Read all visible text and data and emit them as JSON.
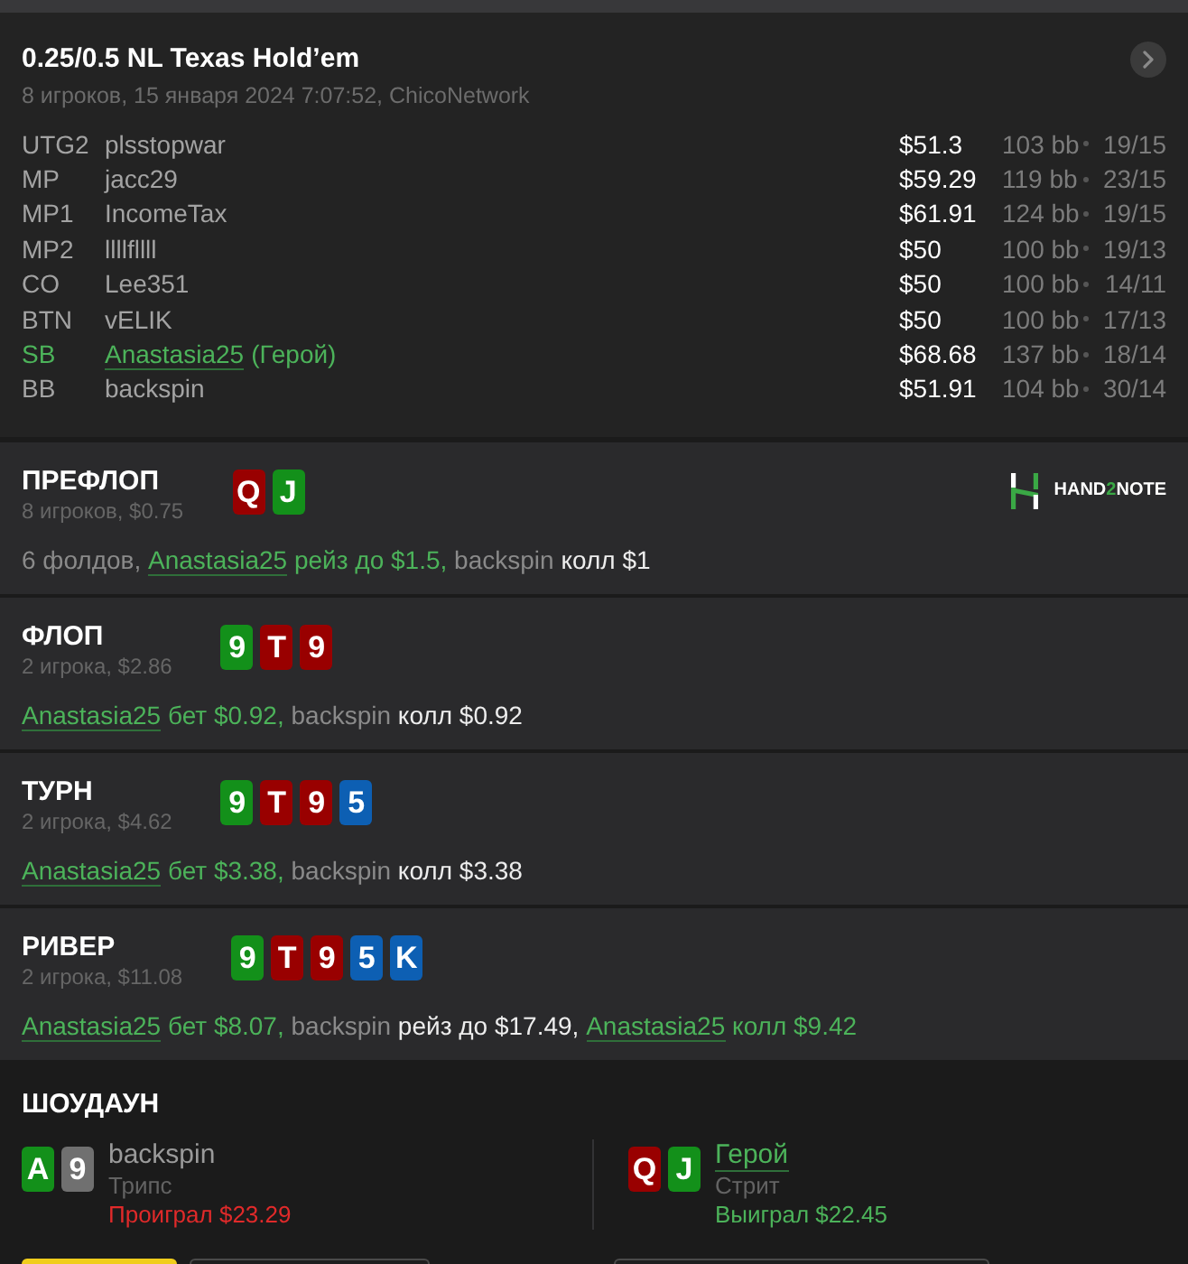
{
  "hand": {
    "title": "0.25/0.5 NL Texas Hold’em",
    "subtitle": "8 игроков, 15 января 2024 7:07:52, ChicoNetwork"
  },
  "players": [
    {
      "position": "UTG2",
      "name": "plsstopwar",
      "hero": false,
      "stack": "$51.3",
      "bb": "103 bb",
      "stats": "19/15"
    },
    {
      "position": "MP",
      "name": "jacc29",
      "hero": false,
      "stack": "$59.29",
      "bb": "119 bb",
      "stats": "23/15"
    },
    {
      "position": "MP1",
      "name": "IncomeTax",
      "hero": false,
      "stack": "$61.91",
      "bb": "124 bb",
      "stats": "19/15"
    },
    {
      "position": "MP2",
      "name": "llllfllll",
      "hero": false,
      "stack": "$50",
      "bb": "100 bb",
      "stats": "19/13"
    },
    {
      "position": "CO",
      "name": "Lee351",
      "hero": false,
      "stack": "$50",
      "bb": "100 bb",
      "stats": "14/11"
    },
    {
      "position": "BTN",
      "name": "vELIK",
      "hero": false,
      "stack": "$50",
      "bb": "100 bb",
      "stats": "17/13"
    },
    {
      "position": "SB",
      "name": "Anastasia25",
      "hero_tag": "(Герой)",
      "hero": true,
      "stack": "$68.68",
      "bb": "137 bb",
      "stats": "18/14"
    },
    {
      "position": "BB",
      "name": "backspin",
      "hero": false,
      "stack": "$51.91",
      "bb": "104 bb",
      "stats": "30/14"
    }
  ],
  "streets": [
    {
      "title": "ПРЕФЛОП",
      "subtitle": "8 игроков, $0.75",
      "cards": [
        {
          "rank": "Q",
          "color": "#990000"
        },
        {
          "rank": "J",
          "color": "#13901a"
        }
      ],
      "logo": {
        "text": "HAND",
        "accent": "2",
        "suffix": "NOTE"
      },
      "actions": [
        {
          "kind": "summary",
          "text": "6 фолдов,"
        },
        {
          "kind": "hero",
          "player": "Anastasia25",
          "action": "рейз до $1.5,"
        },
        {
          "kind": "villain",
          "player": "backspin",
          "action": "колл $1"
        }
      ]
    },
    {
      "title": "ФЛОП",
      "subtitle": "2 игрока, $2.86",
      "cards": [
        {
          "rank": "9",
          "color": "#13901a"
        },
        {
          "rank": "T",
          "color": "#990000"
        },
        {
          "rank": "9",
          "color": "#990000"
        }
      ],
      "actions": [
        {
          "kind": "hero",
          "player": "Anastasia25",
          "action": "бет $0.92,"
        },
        {
          "kind": "villain",
          "player": "backspin",
          "action": "колл $0.92"
        }
      ]
    },
    {
      "title": "ТУРН",
      "subtitle": "2 игрока, $4.62",
      "cards": [
        {
          "rank": "9",
          "color": "#13901a"
        },
        {
          "rank": "T",
          "color": "#990000"
        },
        {
          "rank": "9",
          "color": "#990000"
        },
        {
          "rank": "5",
          "color": "#0d5fb3"
        }
      ],
      "actions": [
        {
          "kind": "hero",
          "player": "Anastasia25",
          "action": "бет $3.38,"
        },
        {
          "kind": "villain",
          "player": "backspin",
          "action": "колл $3.38"
        }
      ]
    },
    {
      "title": "РИВЕР",
      "subtitle": "2 игрока, $11.08",
      "cards": [
        {
          "rank": "9",
          "color": "#13901a"
        },
        {
          "rank": "T",
          "color": "#990000"
        },
        {
          "rank": "9",
          "color": "#990000"
        },
        {
          "rank": "5",
          "color": "#0d5fb3"
        },
        {
          "rank": "K",
          "color": "#0d5fb3"
        }
      ],
      "actions": [
        {
          "kind": "hero",
          "player": "Anastasia25",
          "action": "бет $8.07,"
        },
        {
          "kind": "villain",
          "player": "backspin",
          "action": "рейз до $17.49,"
        },
        {
          "kind": "hero",
          "player": "Anastasia25",
          "action": "колл $9.42"
        }
      ]
    }
  ],
  "showdown": {
    "title": "ШОУДАУН",
    "hands": [
      {
        "cards": [
          {
            "rank": "A",
            "color": "#13901a"
          },
          {
            "rank": "9",
            "color": "#707070"
          }
        ],
        "player": "backspin",
        "hero": false,
        "hand": "Трипс",
        "result": {
          "kind": "loss",
          "text": "Проиграл $23.29"
        }
      },
      {
        "cards": [
          {
            "rank": "Q",
            "color": "#990000"
          },
          {
            "rank": "J",
            "color": "#13901a"
          }
        ],
        "player": "Герой",
        "hero": true,
        "hand": "Стрит",
        "result": {
          "kind": "win",
          "text": "Выиграл $22.45"
        }
      }
    ]
  },
  "footer_buttons": [
    {
      "kind": "primary"
    },
    {
      "kind": "outline"
    },
    {
      "kind": "outline"
    }
  ]
}
